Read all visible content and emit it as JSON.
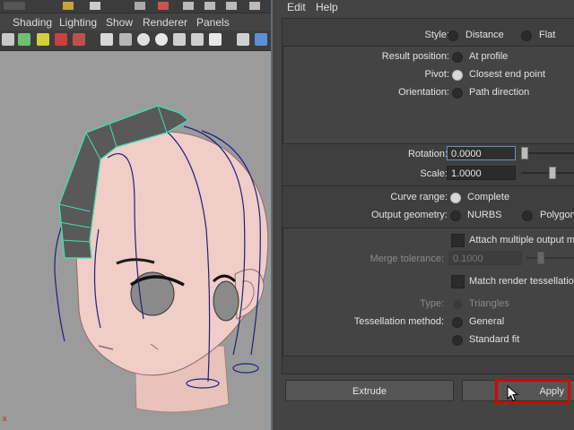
{
  "viewport": {
    "menu": [
      "Shading",
      "Lighting",
      "Show",
      "Renderer",
      "Panels"
    ],
    "axis_label": "x"
  },
  "dialog": {
    "menu": [
      "Edit",
      "Help"
    ],
    "style": {
      "label": "Style:",
      "options": [
        "Distance",
        "Flat"
      ]
    },
    "result_position": {
      "label": "Result position:",
      "option": "At profile"
    },
    "pivot": {
      "label": "Pivot:",
      "option": "Closest end point"
    },
    "orientation": {
      "label": "Orientation:",
      "option": "Path direction"
    },
    "rotation": {
      "label": "Rotation:",
      "value": "0.0000"
    },
    "scale": {
      "label": "Scale:",
      "value": "1.0000"
    },
    "curve_range": {
      "label": "Curve range:",
      "option": "Complete"
    },
    "output_geometry": {
      "label": "Output geometry:",
      "options": [
        "NURBS",
        "Polygons"
      ]
    },
    "attach_multiple": "Attach multiple output me",
    "merge_tolerance": {
      "label": "Merge tolerance:",
      "value": "0.1000"
    },
    "match_render": "Match render tessellation",
    "type": {
      "label": "Type:",
      "option": "Triangles"
    },
    "tessellation": {
      "label": "Tessellation method:",
      "options": [
        "General",
        "Standard fit"
      ]
    },
    "buttons": {
      "extrude": "Extrude",
      "apply": "Apply"
    }
  }
}
